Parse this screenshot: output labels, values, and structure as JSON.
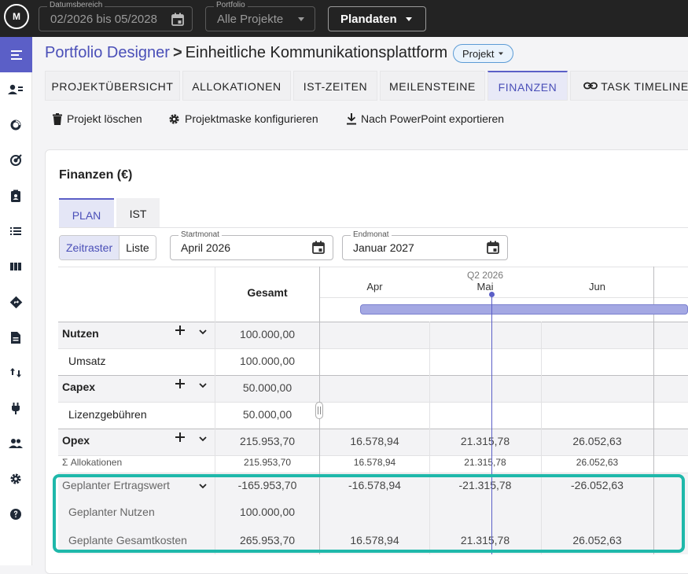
{
  "topbar": {
    "logo": "M",
    "date_range": {
      "label": "Datumsbereich",
      "value": "02/2026 bis 05/2028"
    },
    "portfolio": {
      "label": "Portfolio",
      "value": "Alle Projekte"
    },
    "plan_button": "Plandaten"
  },
  "breadcrumb": {
    "parent": "Portfolio Designer",
    "current": "Einheitliche Kommunikationsplattform",
    "badge": "Projekt"
  },
  "tabs": [
    "PROJEKTÜBERSICHT",
    "ALLOKATIONEN",
    "IST-ZEITEN",
    "MEILENSTEINE",
    "FINANZEN",
    "TASK TIMELINE"
  ],
  "active_tab": "FINANZEN",
  "actions": {
    "delete": "Projekt löschen",
    "configure": "Projektmaske konfigurieren",
    "export": "Nach PowerPoint exportieren"
  },
  "finance": {
    "title": "Finanzen (€)",
    "subtabs": [
      "PLAN",
      "IST"
    ],
    "view_toggle": [
      "Zeitraster",
      "Liste"
    ],
    "start": {
      "label": "Startmonat",
      "value": "April 2026"
    },
    "end": {
      "label": "Endmonat",
      "value": "Januar 2027"
    },
    "header": {
      "total": "Gesamt",
      "quarter": "Q2 2026",
      "months": [
        "Apr",
        "Mai",
        "Jun"
      ]
    },
    "rows": [
      {
        "label": "Nutzen",
        "total": "100.000,00",
        "cells": [
          "",
          "",
          ""
        ]
      },
      {
        "label": "Umsatz",
        "total": "100.000,00",
        "cells": [
          "",
          "",
          ""
        ]
      },
      {
        "label": "Capex",
        "total": "50.000,00",
        "cells": [
          "",
          "",
          ""
        ]
      },
      {
        "label": "Lizenzgebühren",
        "total": "50.000,00",
        "cells": [
          "",
          "",
          ""
        ]
      },
      {
        "label": "Opex",
        "total": "215.953,70",
        "cells": [
          "16.578,94",
          "21.315,78",
          "26.052,63"
        ]
      },
      {
        "label": "Σ Allokationen",
        "total": "215.953,70",
        "cells": [
          "16.578,94",
          "21.315,78",
          "26.052,63"
        ]
      },
      {
        "label": "Geplanter Ertragswert",
        "total": "-165.953,70",
        "cells": [
          "-16.578,94",
          "-21.315,78",
          "-26.052,63"
        ]
      },
      {
        "label": "Geplanter Nutzen",
        "total": "100.000,00",
        "cells": [
          "",
          "",
          ""
        ]
      },
      {
        "label": "Geplante Gesamtkosten",
        "total": "265.953,70",
        "cells": [
          "16.578,94",
          "21.315,78",
          "26.052,63"
        ]
      }
    ]
  },
  "colors": {
    "accent": "#5b5fc7",
    "highlight": "#1fb8aa",
    "topbar": "#232323"
  }
}
